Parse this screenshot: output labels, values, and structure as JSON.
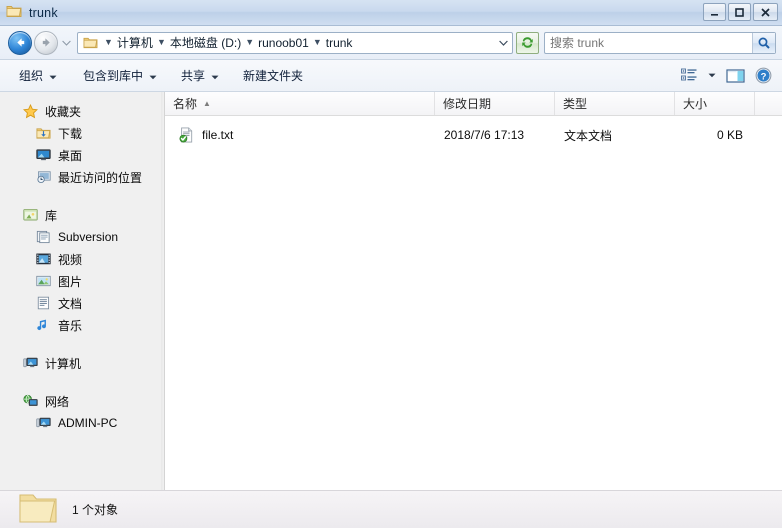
{
  "window": {
    "title": "trunk",
    "icon": "folder-icon",
    "controls": {
      "minimize": "minimize-button",
      "maximize": "maximize-button",
      "close": "close-button"
    }
  },
  "nav": {
    "back": "back-button",
    "forward": "forward-button",
    "history": "recent-pages-button",
    "address": {
      "icon": "folder-icon",
      "crumbs": [
        "计算机",
        "本地磁盘 (D:)",
        "runoob01",
        "trunk"
      ],
      "dropdown": "address-dropdown"
    },
    "refresh": "refresh-button",
    "search": {
      "placeholder": "搜索 trunk",
      "value": "",
      "button": "search-button"
    }
  },
  "toolbar": {
    "items": [
      {
        "label": "组织",
        "caret": true
      },
      {
        "label": "包含到库中",
        "caret": true
      },
      {
        "label": "共享",
        "caret": true
      },
      {
        "label": "新建文件夹",
        "caret": false
      }
    ],
    "view_button": "change-view-button",
    "view_caret": "change-view-dropdown",
    "preview_button": "preview-pane-button",
    "help_button": "help-button"
  },
  "sidebar": {
    "groups": [
      {
        "header": {
          "label": "收藏夹",
          "icon": "star-icon"
        },
        "items": [
          {
            "label": "下载",
            "icon": "downloads-folder-icon"
          },
          {
            "label": "桌面",
            "icon": "desktop-icon"
          },
          {
            "label": "最近访问的位置",
            "icon": "recent-places-icon"
          }
        ]
      },
      {
        "header": {
          "label": "库",
          "icon": "library-icon"
        },
        "items": [
          {
            "label": "Subversion",
            "icon": "subversion-library-icon"
          },
          {
            "label": "视频",
            "icon": "video-library-icon"
          },
          {
            "label": "图片",
            "icon": "pictures-library-icon"
          },
          {
            "label": "文档",
            "icon": "documents-library-icon"
          },
          {
            "label": "音乐",
            "icon": "music-library-icon"
          }
        ]
      },
      {
        "header": {
          "label": "计算机",
          "icon": "computer-icon"
        },
        "items": []
      },
      {
        "header": {
          "label": "网络",
          "icon": "network-icon"
        },
        "items": [
          {
            "label": "ADMIN-PC",
            "icon": "computer-icon"
          }
        ]
      }
    ]
  },
  "filelist": {
    "columns": [
      {
        "label": "名称",
        "sorted": "asc"
      },
      {
        "label": "修改日期",
        "sorted": ""
      },
      {
        "label": "类型",
        "sorted": ""
      },
      {
        "label": "大小",
        "sorted": ""
      }
    ],
    "sort_mark": "▲",
    "rows": [
      {
        "name": "file.txt",
        "icon": "text-file-svn-normal-icon",
        "date": "2018/7/6 17:13",
        "type": "文本文档",
        "size": "0 KB"
      }
    ]
  },
  "statusbar": {
    "icon": "folder-icon",
    "text": "1 个对象"
  },
  "colors": {
    "titlebar": "#c9d9ee",
    "accent_blue": "#2f86d8",
    "svn_green": "#3fa535",
    "folder_yellow": "#f6d98f",
    "list_bg": "#ffffff",
    "sidebar_bg": "#f0f0f0"
  }
}
